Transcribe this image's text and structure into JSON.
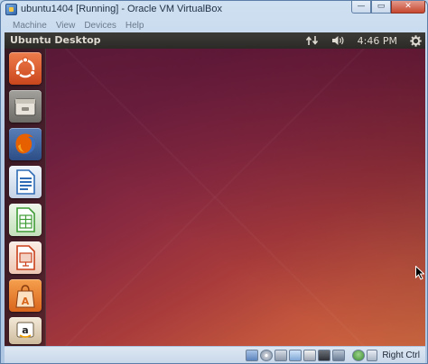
{
  "window": {
    "title": "ubuntu1404 [Running] - Oracle VM VirtualBox",
    "minimize_symbol": "—",
    "maximize_symbol": "▭",
    "close_symbol": "✕"
  },
  "menubar": {
    "items": [
      {
        "label": "Machine"
      },
      {
        "label": "View"
      },
      {
        "label": "Devices"
      },
      {
        "label": "Help"
      }
    ]
  },
  "guest": {
    "panel": {
      "title": "Ubuntu Desktop",
      "clock": "4:46 PM",
      "indicators": [
        "network-icon",
        "volume-icon",
        "clock",
        "power-gear-icon"
      ]
    },
    "launcher": {
      "items": [
        {
          "name": "dash-home-icon"
        },
        {
          "name": "files-icon"
        },
        {
          "name": "firefox-icon"
        },
        {
          "name": "libreoffice-writer-icon"
        },
        {
          "name": "libreoffice-calc-icon"
        },
        {
          "name": "libreoffice-impress-icon"
        },
        {
          "name": "ubuntu-software-center-icon"
        },
        {
          "name": "amazon-icon"
        }
      ]
    },
    "colors": {
      "launcher_home": "#e05a28",
      "firefox": "#e66000",
      "writer": "#2f6cb5",
      "calc": "#3f9c35",
      "impress": "#c9401a",
      "software_center": "#e8812f"
    }
  },
  "statusbar": {
    "icons": [
      "hard-disk-icon",
      "optical-drive-icon",
      "usb-icon",
      "shared-folders-icon",
      "display-icon",
      "video-capture-icon",
      "network-adapter-icon",
      "mouse-integration-icon"
    ],
    "host_key": "Right Ctrl"
  }
}
